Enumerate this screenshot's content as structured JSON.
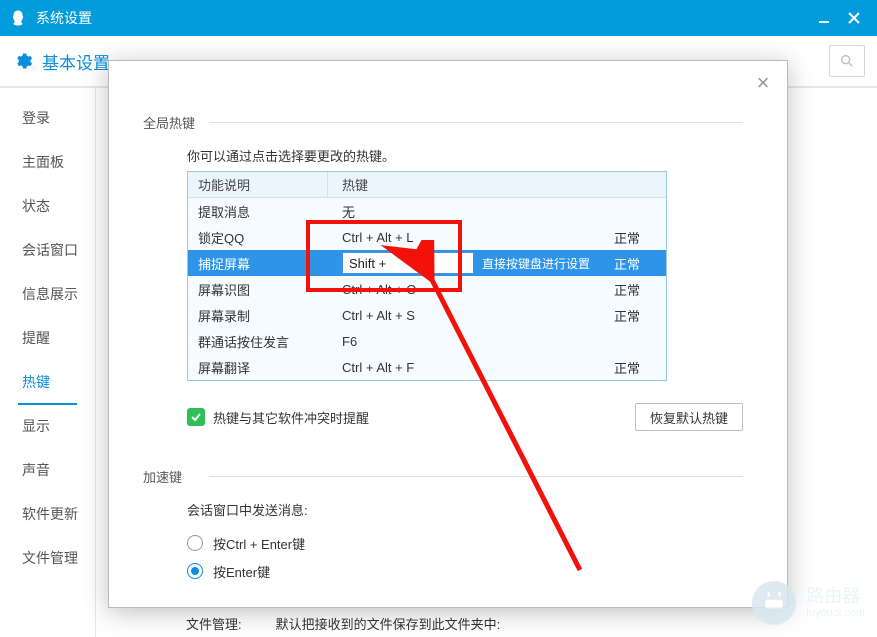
{
  "window": {
    "title": "系统设置"
  },
  "header": {
    "tabs": [
      "基本设置"
    ],
    "search_placeholder": ""
  },
  "sidebar": {
    "items": [
      {
        "label": "登录"
      },
      {
        "label": "主面板"
      },
      {
        "label": "状态"
      },
      {
        "label": "会话窗口"
      },
      {
        "label": "信息展示"
      },
      {
        "label": "提醒"
      },
      {
        "label": "热键",
        "active": true
      },
      {
        "label": "显示"
      },
      {
        "label": "声音"
      },
      {
        "label": "软件更新"
      },
      {
        "label": "文件管理"
      }
    ]
  },
  "modal": {
    "section1_label": "全局热键",
    "desc": "你可以通过点击选择要更改的热键。",
    "table_headers": {
      "c1": "功能说明",
      "c2": "热键"
    },
    "rows": [
      {
        "name": "提取消息",
        "key": "无",
        "status": ""
      },
      {
        "name": "锁定QQ",
        "key": "Ctrl + Alt + L",
        "status": "正常"
      },
      {
        "name": "捕捉屏幕",
        "key": "Shift + ",
        "hint": "直接按键盘进行设置",
        "status": "正常",
        "selected": true,
        "editing": true
      },
      {
        "name": "屏幕识图",
        "key": "Ctrl + Alt + O",
        "status": "正常"
      },
      {
        "name": "屏幕录制",
        "key": "Ctrl + Alt + S",
        "status": "正常"
      },
      {
        "name": "群通话按住发言",
        "key": "F6",
        "status": ""
      },
      {
        "name": "屏幕翻译",
        "key": "Ctrl + Alt + F",
        "status": "正常"
      }
    ],
    "conflict_label": "热键与其它软件冲突时提醒",
    "restore_btn": "恢复默认热键",
    "section2_label": "加速键",
    "send_label": "会话窗口中发送消息:",
    "radio1": "按Ctrl + Enter键",
    "radio2": "按Enter键"
  },
  "footer_row": {
    "label": "文件管理:",
    "text": "默认把接收到的文件保存到此文件夹中:"
  },
  "watermark": {
    "big": "路由器",
    "small": "luyouqi.com"
  }
}
